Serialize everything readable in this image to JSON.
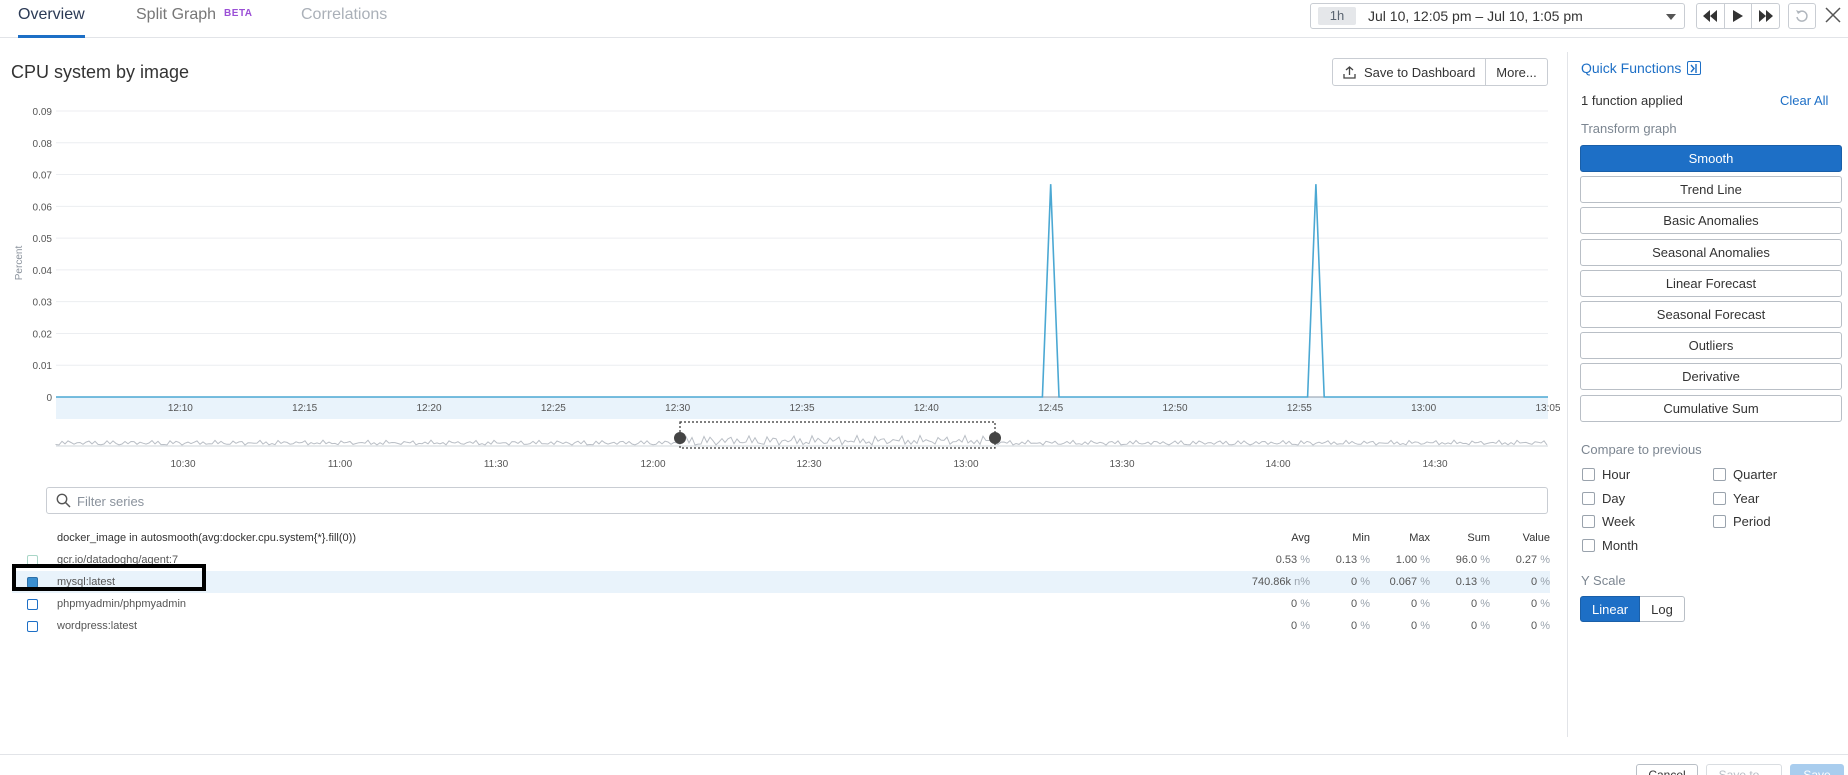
{
  "tabs": [
    {
      "label": "Overview"
    },
    {
      "label": "Split Graph",
      "badge": "BETA"
    },
    {
      "label": "Correlations"
    }
  ],
  "timepicker": {
    "duration": "1h",
    "range": "Jul 10, 12:05 pm – Jul 10, 1:05 pm"
  },
  "graph": {
    "title": "CPU system by image",
    "save_label": "Save to Dashboard",
    "more_label": "More..."
  },
  "chart_data": {
    "type": "line",
    "ylabel": "Percent",
    "ylim": [
      0,
      0.09
    ],
    "yticks": [
      "0",
      "0.01",
      "0.02",
      "0.03",
      "0.04",
      "0.05",
      "0.06",
      "0.07",
      "0.08",
      "0.09"
    ],
    "xticks": [
      "12:10",
      "12:15",
      "12:20",
      "12:25",
      "12:30",
      "12:35",
      "12:40",
      "12:45",
      "12:50",
      "12:55",
      "13:00",
      "13:05"
    ],
    "x_range": [
      "12:05",
      "13:05"
    ],
    "series": [
      {
        "color": "#4ba8d3",
        "points": [
          [
            "12:05",
            0
          ],
          [
            "12:44:40",
            0
          ],
          [
            "12:45",
            0.067
          ],
          [
            "12:45:20",
            0
          ],
          [
            "12:55:20",
            0
          ],
          [
            "12:55:40",
            0.067
          ],
          [
            "12:56",
            0
          ],
          [
            "13:05",
            0
          ]
        ]
      }
    ],
    "overview_ticks": [
      "10:30",
      "11:00",
      "11:30",
      "12:00",
      "12:30",
      "13:00",
      "13:30",
      "14:00",
      "14:30"
    ]
  },
  "filter": {
    "placeholder": "Filter series"
  },
  "legend": {
    "query": "docker_image in autosmooth(avg:docker.cpu.system{*}.fill(0))",
    "columns": [
      "Avg",
      "Min",
      "Max",
      "Sum",
      "Value"
    ],
    "rows": [
      {
        "name": "gcr.io/datadoghq/agent:7",
        "avg": "0.53",
        "avg_u": "%",
        "min": "0.13",
        "min_u": "%",
        "max": "1.00",
        "max_u": "%",
        "sum": "96.0",
        "sum_u": "%",
        "value": "0.27",
        "value_u": "%"
      },
      {
        "name": "mysql:latest",
        "avg": "740.86k",
        "avg_u": "n%",
        "min": "0",
        "min_u": "%",
        "max": "0.067",
        "max_u": "%",
        "sum": "0.13",
        "sum_u": "%",
        "value": "0",
        "value_u": "%"
      },
      {
        "name": "phpmyadmin/phpmyadmin",
        "avg": "0",
        "avg_u": "%",
        "min": "0",
        "min_u": "%",
        "max": "0",
        "max_u": "%",
        "sum": "0",
        "sum_u": "%",
        "value": "0",
        "value_u": "%"
      },
      {
        "name": "wordpress:latest",
        "avg": "0",
        "avg_u": "%",
        "min": "0",
        "min_u": "%",
        "max": "0",
        "max_u": "%",
        "sum": "0",
        "sum_u": "%",
        "value": "0",
        "value_u": "%"
      }
    ]
  },
  "quick_functions": {
    "title": "Quick Functions",
    "applied": "1 function applied",
    "clear_all": "Clear All",
    "transform_label": "Transform graph",
    "functions": [
      "Smooth",
      "Trend Line",
      "Basic Anomalies",
      "Seasonal Anomalies",
      "Linear Forecast",
      "Seasonal Forecast",
      "Outliers",
      "Derivative",
      "Cumulative Sum"
    ],
    "compare_label": "Compare to previous",
    "compare": [
      "Hour",
      "Quarter",
      "Day",
      "Year",
      "Week",
      "Period",
      "Month"
    ],
    "yscale_label": "Y Scale",
    "yscale": [
      "Linear",
      "Log"
    ]
  },
  "footer": {
    "cancel": "Cancel",
    "save_to": "Save to...",
    "save": "Save"
  }
}
